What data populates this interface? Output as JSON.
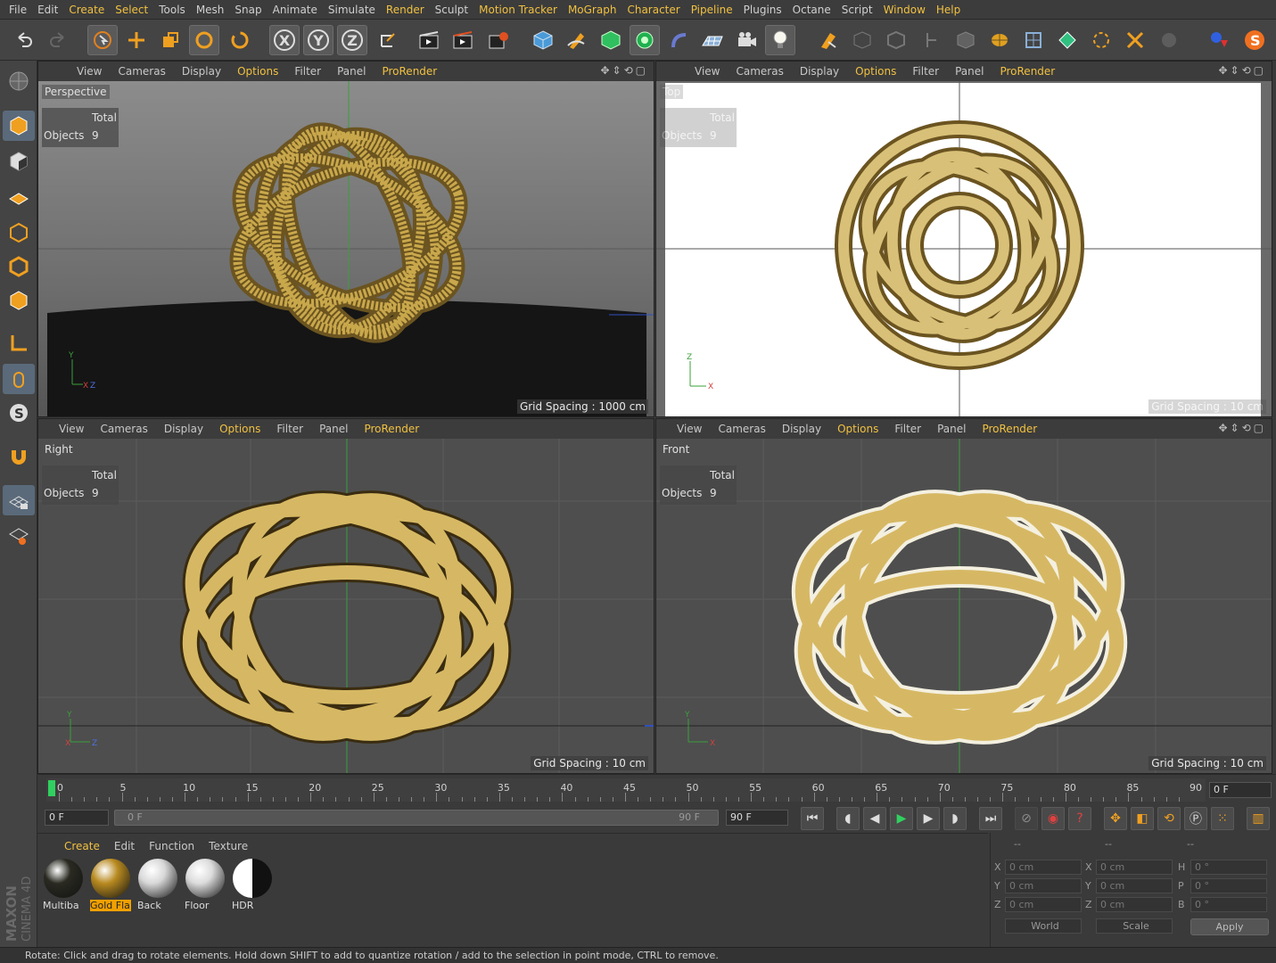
{
  "menu": [
    "File",
    "Edit",
    "Create",
    "Select",
    "Tools",
    "Mesh",
    "Snap",
    "Animate",
    "Simulate",
    "Render",
    "Sculpt",
    "Motion Tracker",
    "MoGraph",
    "Character",
    "Pipeline",
    "Plugins",
    "Octane",
    "Script",
    "Window",
    "Help"
  ],
  "menu_highlight": [
    "Create",
    "Select",
    "Render",
    "Motion Tracker",
    "MoGraph",
    "Character",
    "Pipeline",
    "Window",
    "Help"
  ],
  "toolbar": {
    "axis_x": "X",
    "axis_y": "Y",
    "axis_z": "Z"
  },
  "viewport_menu": {
    "view": "View",
    "cameras": "Cameras",
    "display": "Display",
    "options": "Options",
    "filter": "Filter",
    "panel": "Panel",
    "prorender": "ProRender"
  },
  "viewports": {
    "perspective": {
      "name": "Perspective",
      "total": "Total",
      "objects_label": "Objects",
      "objects_count": "9",
      "grid": "Grid Spacing : 1000 cm"
    },
    "top": {
      "name": "Top",
      "total": "Total",
      "objects_label": "Objects",
      "objects_count": "9",
      "grid": "Grid Spacing : 10 cm"
    },
    "right": {
      "name": "Right",
      "total": "Total",
      "objects_label": "Objects",
      "objects_count": "9",
      "grid": "Grid Spacing : 10 cm"
    },
    "front": {
      "name": "Front",
      "total": "Total",
      "objects_label": "Objects",
      "objects_count": "9",
      "grid": "Grid Spacing : 10 cm"
    }
  },
  "timeline": {
    "ticks": [
      "0",
      "5",
      "10",
      "15",
      "20",
      "25",
      "30",
      "35",
      "40",
      "45",
      "50",
      "55",
      "60",
      "65",
      "70",
      "75",
      "80",
      "85",
      "90"
    ],
    "current_frame": "0 F",
    "start_frame": "0 F",
    "range_start": "0 F",
    "range_end": "90 F",
    "end_frame": "90 F"
  },
  "material_menu": {
    "create": "Create",
    "edit": "Edit",
    "function": "Function",
    "texture": "Texture"
  },
  "materials": [
    {
      "name": "Multiba",
      "color": "#2a2a22"
    },
    {
      "name": "Gold Fla",
      "color": "#b88a20",
      "selected": true
    },
    {
      "name": "Back",
      "color": "#d8d8d8"
    },
    {
      "name": "Floor",
      "color": "#dcdcdc"
    },
    {
      "name": "HDR",
      "color": "#888888"
    }
  ],
  "coords": {
    "headers": [
      "--",
      "--",
      "--"
    ],
    "rows": [
      {
        "a": "X",
        "av": "0 cm",
        "b": "X",
        "bv": "0 cm",
        "c": "H",
        "cv": "0 °"
      },
      {
        "a": "Y",
        "av": "0 cm",
        "b": "Y",
        "bv": "0 cm",
        "c": "P",
        "cv": "0 °"
      },
      {
        "a": "Z",
        "av": "0 cm",
        "b": "Z",
        "bv": "0 cm",
        "c": "B",
        "cv": "0 °"
      }
    ],
    "world": "World",
    "scale": "Scale",
    "apply": "Apply"
  },
  "status": "Rotate: Click and drag to rotate elements. Hold down SHIFT to add to quantize rotation / add to the selection in point mode, CTRL to remove.",
  "logo": {
    "brand": "MAXON",
    "product": "CINEMA 4D"
  },
  "colors": {
    "accent": "#f0c040",
    "gold": "#c9a84c",
    "gold_dark": "#6b5420"
  }
}
